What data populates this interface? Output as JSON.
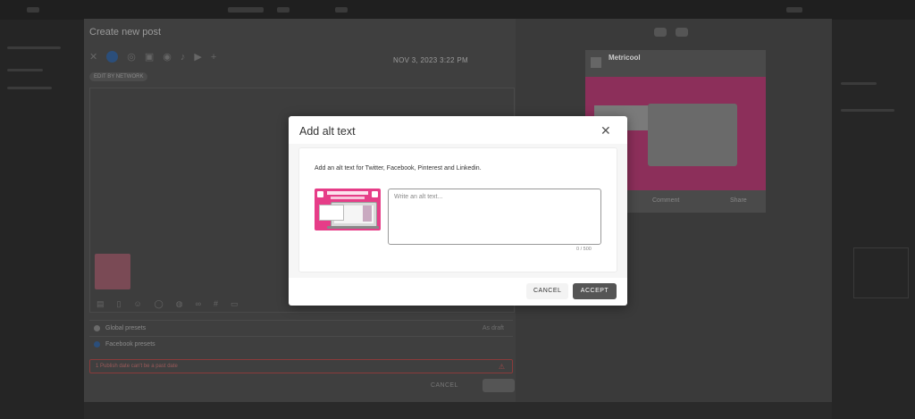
{
  "background": {
    "editor_title": "Create new post",
    "network_tag": "EDIT BY NETWORK",
    "datetime": "NOV 3, 2023 3:22 PM",
    "global_presets": "Global presets",
    "facebook_presets": "Facebook presets",
    "as_draft": "As draft",
    "error_text": "1 Publish date can't be a past date",
    "cancel_label": "CANCEL",
    "preview_brand": "Metricool",
    "preview_comment": "Comment",
    "preview_share": "Share"
  },
  "modal": {
    "title": "Add alt text",
    "instructions": "Add an alt text for Twitter, Facebook, Pinterest and Linkedin.",
    "alt_input": {
      "value": "",
      "placeholder": "Write an alt text..."
    },
    "counter": "0 / 500",
    "cancel_label": "CANCEL",
    "accept_label": "ACCEPT"
  },
  "icons": {
    "close": "close-icon",
    "image": "image-thumbnail-icon"
  },
  "colors": {
    "overlay": "#2a2a2a",
    "accept_button": "#555555",
    "thumbnail_pink": "#e63d88"
  }
}
